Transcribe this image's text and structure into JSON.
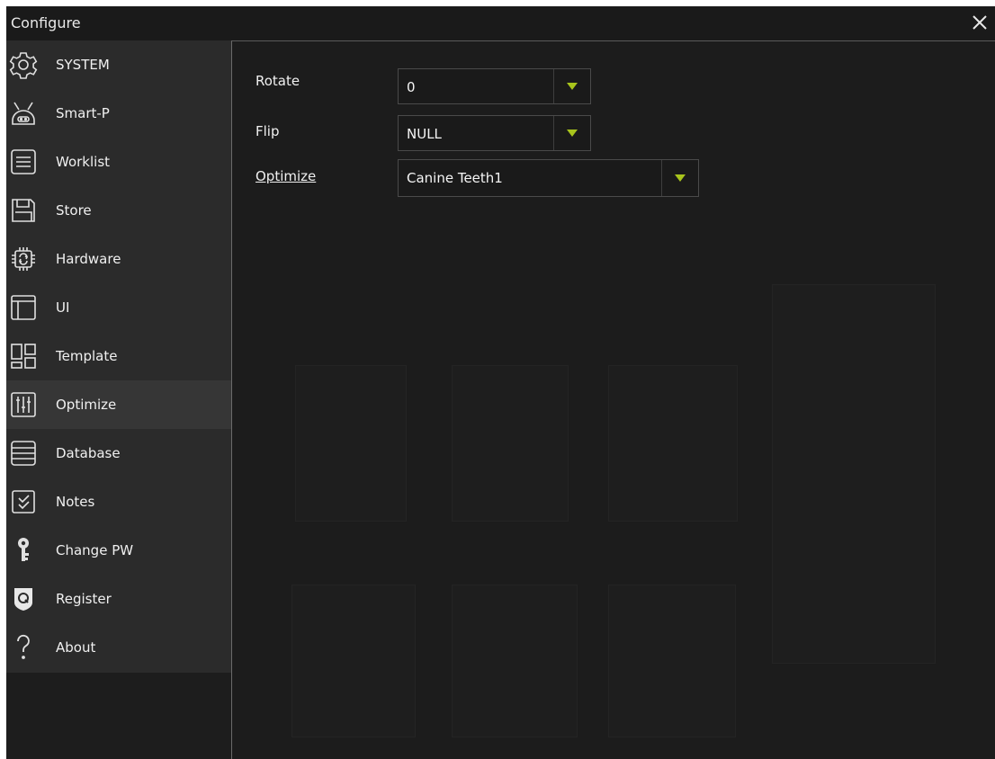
{
  "window": {
    "title": "Configure"
  },
  "sidebar": {
    "items": [
      {
        "label": "SYSTEM",
        "icon": "gear-icon"
      },
      {
        "label": "Smart-P",
        "icon": "robot-icon"
      },
      {
        "label": "Worklist",
        "icon": "list-icon"
      },
      {
        "label": "Store",
        "icon": "floppy-disk-icon"
      },
      {
        "label": "Hardware",
        "icon": "chip-icon"
      },
      {
        "label": "UI",
        "icon": "layout-icon"
      },
      {
        "label": "Template",
        "icon": "template-grid-icon"
      },
      {
        "label": "Optimize",
        "icon": "sliders-icon"
      },
      {
        "label": "Database",
        "icon": "database-icon"
      },
      {
        "label": "Notes",
        "icon": "notes-check-icon"
      },
      {
        "label": "Change PW",
        "icon": "key-icon"
      },
      {
        "label": "Register",
        "icon": "shield-q-icon"
      },
      {
        "label": "About",
        "icon": "question-mark-icon"
      }
    ],
    "active": "Optimize"
  },
  "form": {
    "rotate": {
      "label": "Rotate",
      "value": "0"
    },
    "flip": {
      "label": "Flip",
      "value": "NULL"
    },
    "optimize": {
      "label": "Optimize",
      "value": "Canine Teeth1"
    }
  },
  "colors": {
    "accent": "#a8c41c",
    "background": "#1f1f1f",
    "sidebar": "#2b2b2b",
    "active_item": "#363636"
  }
}
